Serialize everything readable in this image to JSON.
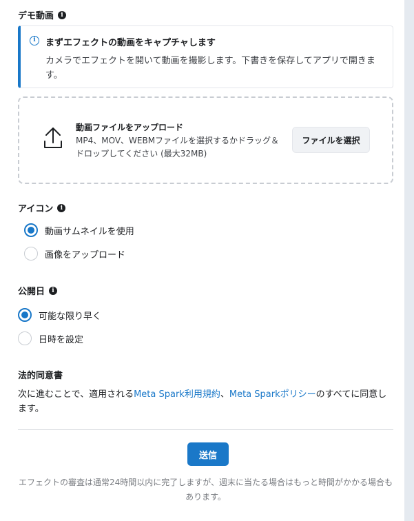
{
  "demo_video": {
    "title": "デモ動画",
    "notice_title": "まずエフェクトの動画をキャプチャします",
    "notice_body": "カメラでエフェクトを開いて動画を撮影します。下書きを保存してアプリで開きます。",
    "upload_title": "動画ファイルをアップロード",
    "upload_desc": "MP4、MOV、WEBMファイルを選択するかドラッグ＆ドロップしてください (最大32MB)",
    "choose_file_label": "ファイルを選択"
  },
  "icon_section": {
    "title": "アイコン",
    "options": [
      {
        "label": "動画サムネイルを使用",
        "checked": true
      },
      {
        "label": "画像をアップロード",
        "checked": false
      }
    ]
  },
  "publish_date": {
    "title": "公開日",
    "options": [
      {
        "label": "可能な限り早く",
        "checked": true
      },
      {
        "label": "日時を設定",
        "checked": false
      }
    ]
  },
  "legal": {
    "title": "法的同意書",
    "text_before": "次に進むことで、適用される",
    "link1": "Meta Spark利用規約",
    "text_middle": "、",
    "link2": "Meta Sparkポリシー",
    "text_after": "のすべてに同意します。"
  },
  "submit_label": "送信",
  "footnote": "エフェクトの審査は通常24時間以内に完了しますが、週末に当たる場合はもっと時間がかかる場合もあります。",
  "colors": {
    "accent": "#1877c8",
    "primary_button": "#1a78c8"
  }
}
